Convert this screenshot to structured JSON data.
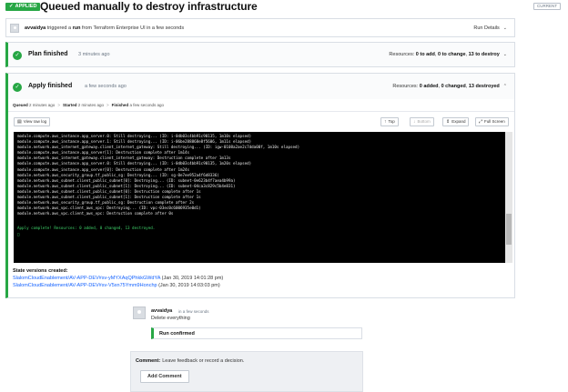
{
  "header": {
    "status_badge": "APPLIED",
    "title": "Queued manually to destroy infrastructure",
    "current_badge": "CURRENT"
  },
  "trigger": {
    "user": "avvaidya",
    "text_mid": " triggered a ",
    "run_word": "run",
    "text_end": " from Terraform Enterprise UI in a few seconds",
    "run_details_label": "Run Details"
  },
  "plan": {
    "title": "Plan finished",
    "time": "3 minutes ago",
    "resources_label": "Resources: ",
    "to_add": "0 to add",
    "sep1": ", ",
    "to_change": "0 to change",
    "sep2": ", ",
    "to_destroy": "13 to destroy"
  },
  "apply": {
    "title": "Apply finished",
    "time": "a few seconds ago",
    "resources_label": "Resources: ",
    "added": "0 added",
    "sep1": ", ",
    "changed": "0 changed",
    "sep2": ", ",
    "destroyed": "13 destroyed",
    "queued_label": "Queued",
    "queued_time": "2 minutes ago",
    "started_label": "Started",
    "started_time": "2 minutes ago",
    "finished_label": "Finished",
    "finished_time": "a few seconds ago"
  },
  "toolbar": {
    "view_raw_log": "View raw log",
    "top": "Top",
    "bottom": "Bottom",
    "expand": "Expand",
    "full_screen": "Full Screen"
  },
  "terminal": {
    "lines": [
      "module.compute.aws_instance.app_server.0: Still destroying... (ID: i-0db03c4bb91c90135, 1m10s elapsed)",
      "module.compute.aws_instance.app_server.1: Still destroying... (ID: i-06be288868e8f5606, 1m11s elapsed)",
      "module.network.aws_internet_gateway.client_internet_gateway: Still destroying... (ID: igw-0108a2ae2c7dda00f, 1m10s elapsed)",
      "module.compute.aws_instance.app_server[1]: Destruction complete after 1m14s",
      "module.network.aws_internet_gateway.client_internet_gateway: Destruction complete after 1m13s",
      "module.compute.aws_instance.app_server.0: Still destroying... (ID: i-0db03c4bb91c90135, 1m20s elapsed)",
      "module.compute.aws_instance.app_server[0]: Destruction complete after 1m24s",
      "module.network.aws_security_group.tf_public_sg: Destroying... (ID: sg-0e7ee952a4f6d8336)",
      "module.network.aws_subnet.client_public_subnet[0]: Destroying... (ID: subnet-0e623b4f7aea4b99a)",
      "module.network.aws_subnet.client_public_subnet[1]: Destroying... (ID: subnet-04ca3c829c5b4e831)",
      "module.network.aws_subnet.client_public_subnet[0]: Destruction complete after 1s",
      "module.network.aws_subnet.client_public_subnet[1]: Destruction complete after 1s",
      "module.network.aws_security_group.tf_public_sg: Destruction complete after 2s",
      "module.network.aws_vpc.client_aws_vpc: Destroying... (ID: vpc-03ec0c6006935e0d1)",
      "module.network.aws_vpc.client_aws_vpc: Destruction complete after 0s"
    ],
    "complete_line": "Apply complete! Resources: 0 added, 0 changed, 13 destroyed.",
    "cursor": "□"
  },
  "state_versions": {
    "title": "State versions created:",
    "items": [
      {
        "link": "SlalomCloudEnablement/AV-APP-DEV#sv-yMYXAqQPhkkGWdYA",
        "time": " (Jan 30, 2019 14:01:28 pm)"
      },
      {
        "link": "SlalomCloudEnablement/AV-APP-DEV#sv-V5xn75Ymm9Honchp",
        "time": " (Jan 30, 2019 14:03:03 pm)"
      }
    ]
  },
  "comment": {
    "user": "avvaidya",
    "time": "in a few seconds",
    "body": "Delete everything",
    "confirm": "Run confirmed"
  },
  "new_comment": {
    "label": "Comment:",
    "placeholder": "Leave feedback or record a decision.",
    "button": "Add Comment"
  },
  "colors": {
    "success": "#27a745",
    "link": "#1563ff",
    "terminal_bg": "#000000",
    "terminal_ok": "#3fd36b"
  }
}
